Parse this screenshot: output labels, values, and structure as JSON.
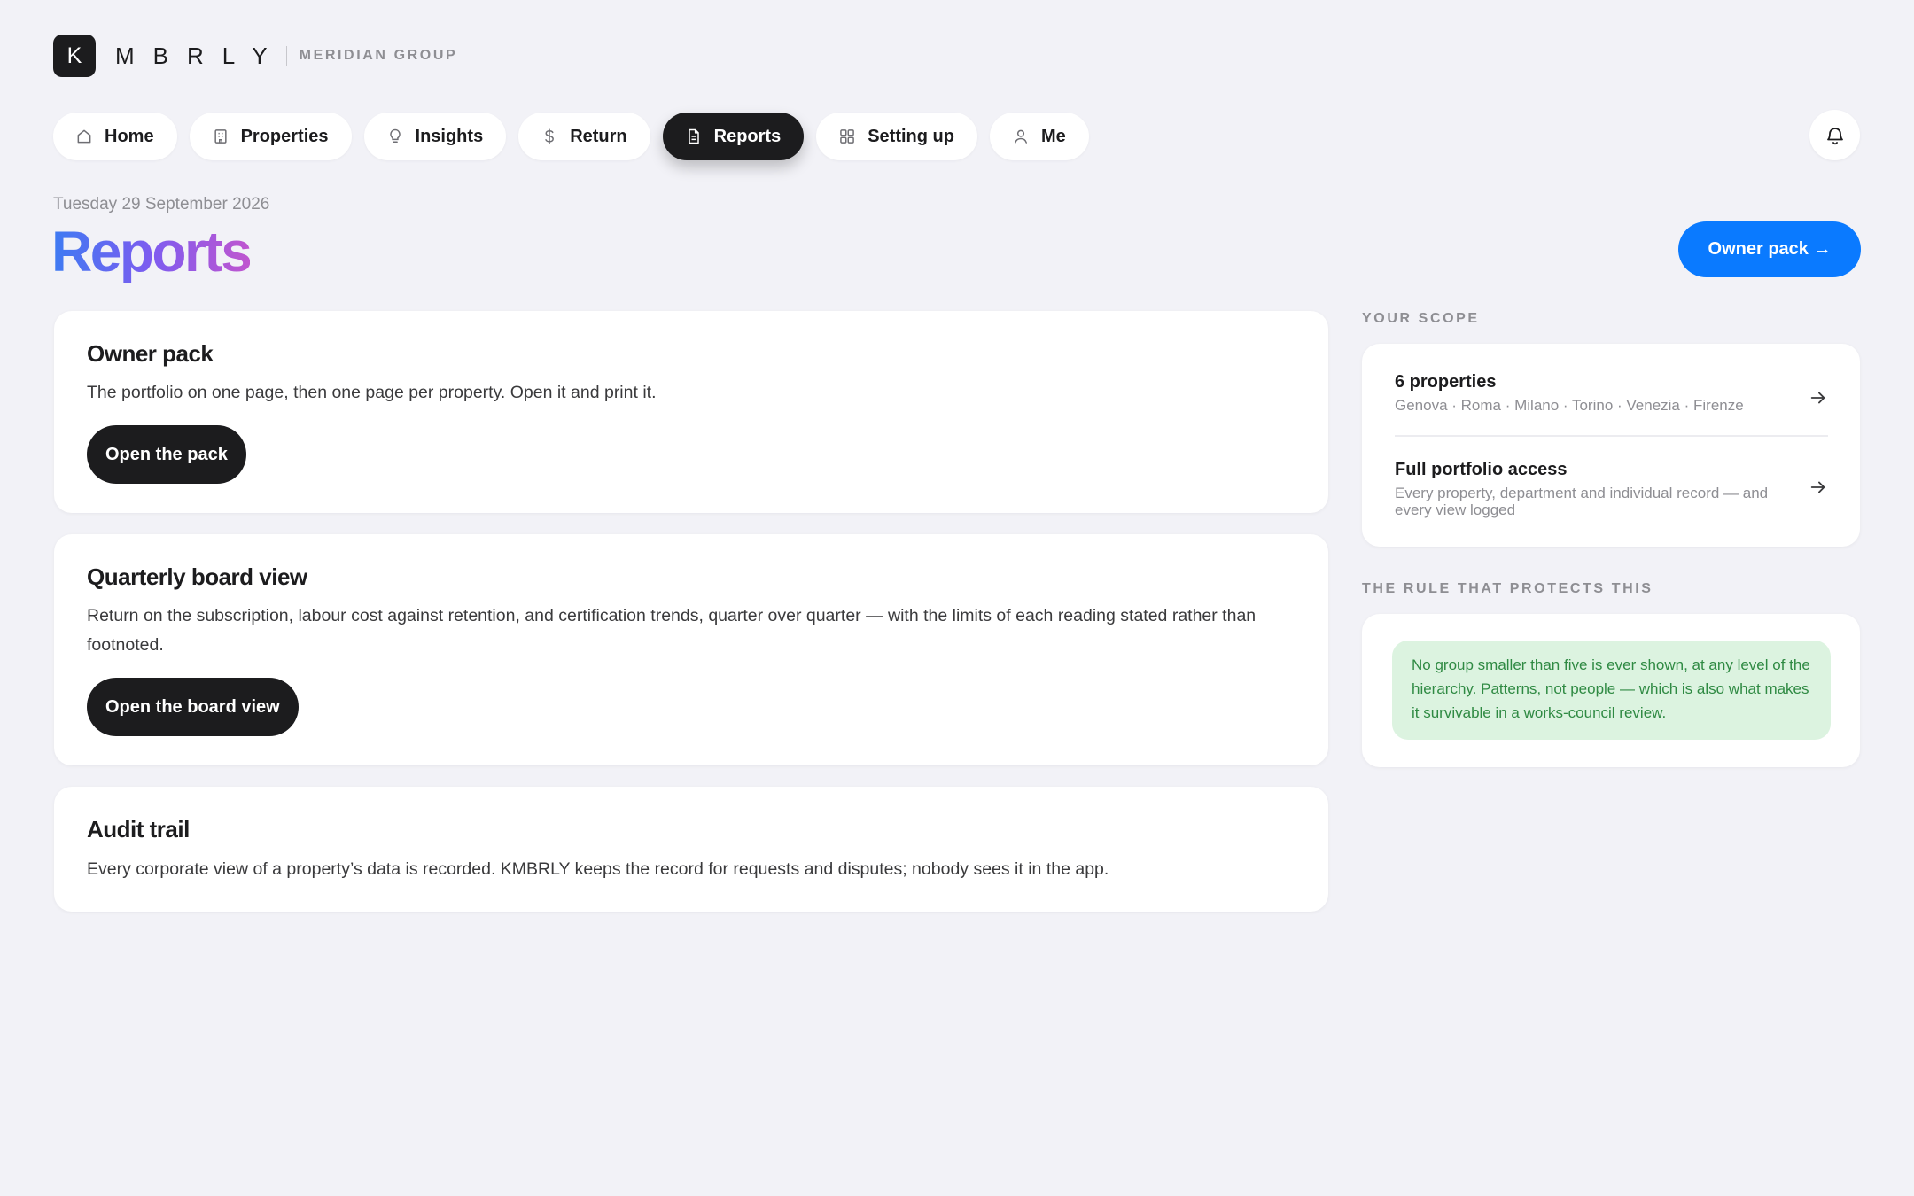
{
  "brand": {
    "logo_letter": "K",
    "wordmark": "MBRLY",
    "group": "MERIDIAN GROUP"
  },
  "nav": {
    "items": [
      {
        "label": "Home",
        "icon": "home-icon"
      },
      {
        "label": "Properties",
        "icon": "building-icon"
      },
      {
        "label": "Insights",
        "icon": "lightbulb-icon"
      },
      {
        "label": "Return",
        "icon": "dollar-icon"
      },
      {
        "label": "Reports",
        "icon": "document-icon",
        "active": true
      },
      {
        "label": "Setting up",
        "icon": "grid-icon"
      },
      {
        "label": "Me",
        "icon": "person-icon"
      }
    ],
    "notifications_icon": "bell-icon"
  },
  "header": {
    "date": "Tuesday 29 September 2026",
    "title": "Reports",
    "cta_label": "Owner pack →"
  },
  "cards": [
    {
      "title": "Owner pack",
      "body": "The portfolio on one page, then one page per property. Open it and print it.",
      "button": "Open the pack"
    },
    {
      "title": "Quarterly board view",
      "body": "Return on the subscription, labour cost against retention, and certification trends, quarter over quarter — with the limits of each reading stated rather than footnoted.",
      "button": "Open the board view"
    },
    {
      "title": "Audit trail",
      "body": "Every corporate view of a property’s data is recorded. KMBRLY keeps the record for requests and disputes; nobody sees it in the app."
    }
  ],
  "sidebar": {
    "scope_label": "YOUR SCOPE",
    "scope_rows": [
      {
        "title": "6 properties",
        "subtitle": "Genova · Roma · Milano · Torino · Venezia · Firenze"
      },
      {
        "title": "Full portfolio access",
        "subtitle": "Every property, department and individual record — and every view logged"
      }
    ],
    "rule_label": "THE RULE THAT PROTECTS THIS",
    "rule_text": "No group smaller than five is ever shown, at any level of the hierarchy. Patterns, not people — which is also what makes it survivable in a works-council review.",
    "colors": {
      "rule_bg": "#dcf3e0",
      "rule_text": "#2f8a43"
    }
  },
  "colors": {
    "accent": "#0a7aff",
    "active_nav": "#1c1c1e",
    "background": "#f2f2f7",
    "title_gradient": [
      "#3d7bf2",
      "#7d5cf0",
      "#c056cf"
    ]
  }
}
